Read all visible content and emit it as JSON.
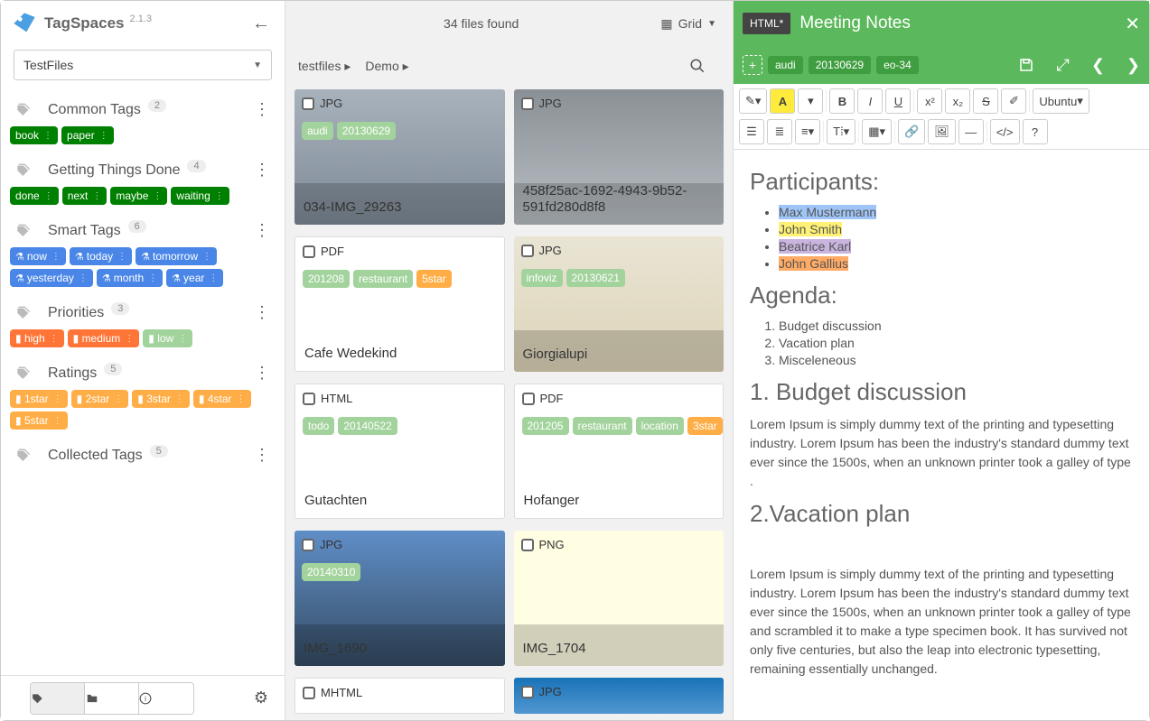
{
  "app": {
    "name": "TagSpaces",
    "version": "2.1.3"
  },
  "location": "TestFiles",
  "sidebar": {
    "groups": [
      {
        "name": "Common Tags",
        "count": "2",
        "tags": [
          {
            "label": "book",
            "color": "tag-green"
          },
          {
            "label": "paper",
            "color": "tag-green"
          }
        ]
      },
      {
        "name": "Getting Things Done",
        "count": "4",
        "tags": [
          {
            "label": "done",
            "color": "tag-green"
          },
          {
            "label": "next",
            "color": "tag-green"
          },
          {
            "label": "maybe",
            "color": "tag-green"
          },
          {
            "label": "waiting",
            "color": "tag-green"
          }
        ]
      },
      {
        "name": "Smart Tags",
        "count": "6",
        "tags": [
          {
            "label": "now",
            "color": "tag-blue",
            "flask": true
          },
          {
            "label": "today",
            "color": "tag-blue",
            "flask": true
          },
          {
            "label": "tomorrow",
            "color": "tag-blue",
            "flask": true
          },
          {
            "label": "yesterday",
            "color": "tag-blue",
            "flask": true
          },
          {
            "label": "month",
            "color": "tag-blue",
            "flask": true
          },
          {
            "label": "year",
            "color": "tag-blue",
            "flask": true
          }
        ]
      },
      {
        "name": "Priorities",
        "count": "3",
        "tags": [
          {
            "label": "high",
            "color": "tag-red",
            "pre": "▮"
          },
          {
            "label": "medium",
            "color": "tag-orange",
            "pre": "▮"
          },
          {
            "label": "low",
            "color": "tag-light",
            "pre": "▮"
          }
        ]
      },
      {
        "name": "Ratings",
        "count": "5",
        "tags": [
          {
            "label": "1star",
            "color": "tag-yellow",
            "pre": "▮"
          },
          {
            "label": "2star",
            "color": "tag-yellow",
            "pre": "▮"
          },
          {
            "label": "3star",
            "color": "tag-yellow",
            "pre": "▮"
          },
          {
            "label": "4star",
            "color": "tag-yellow",
            "pre": "▮"
          },
          {
            "label": "5star",
            "color": "tag-yellow",
            "pre": "▮"
          }
        ]
      },
      {
        "name": "Collected Tags",
        "count": "5",
        "tags": []
      }
    ]
  },
  "main": {
    "count_label": "34 files found",
    "view_label": "Grid",
    "breadcrumbs": [
      "testfiles ▸",
      "Demo ▸"
    ],
    "cards": [
      {
        "type": "JPG",
        "name": "034-IMG_29263",
        "thumb": "eiffel",
        "tags": [
          {
            "label": "audi",
            "color": "tag-light"
          },
          {
            "label": "20130629",
            "color": "tag-light"
          }
        ]
      },
      {
        "type": "JPG",
        "name": "458f25ac-1692-4943-9b52-591fd280d8f8",
        "thumb": "car",
        "tags": []
      },
      {
        "type": "PDF",
        "name": "Cafe Wedekind",
        "doc": true,
        "tags": [
          {
            "label": "201208",
            "color": "tag-light"
          },
          {
            "label": "restaurant",
            "color": "tag-light"
          },
          {
            "label": "5star",
            "color": "tag-yellow"
          }
        ]
      },
      {
        "type": "JPG",
        "name": "Giorgialupi",
        "thumb": "chart",
        "tags": [
          {
            "label": "infoviz",
            "color": "tag-light"
          },
          {
            "label": "20130621",
            "color": "tag-light"
          }
        ]
      },
      {
        "type": "HTML",
        "name": "Gutachten",
        "doc": true,
        "tags": [
          {
            "label": "todo",
            "color": "tag-light"
          },
          {
            "label": "20140522",
            "color": "tag-light"
          }
        ]
      },
      {
        "type": "PDF",
        "name": "Hofanger",
        "doc": true,
        "tags": [
          {
            "label": "201205",
            "color": "tag-light"
          },
          {
            "label": "restaurant",
            "color": "tag-light"
          },
          {
            "label": "location",
            "color": "tag-light"
          },
          {
            "label": "3star",
            "color": "tag-yellow"
          }
        ]
      },
      {
        "type": "JPG",
        "name": "IMG_1690",
        "thumb": "terrace",
        "tags": [
          {
            "label": "20140310",
            "color": "tag-light"
          }
        ]
      },
      {
        "type": "PNG",
        "name": "IMG_1704",
        "thumb": "lead",
        "tags": []
      },
      {
        "type": "MHTML",
        "name": "",
        "doc": true,
        "tags": [],
        "half": true
      },
      {
        "type": "JPG",
        "name": "",
        "thumb": "info",
        "tags": [],
        "half": true
      }
    ]
  },
  "panel": {
    "badge": "HTML*",
    "title": "Meeting Notes",
    "tags": [
      "audi",
      "20130629",
      "eo-34"
    ],
    "font": "Ubuntu",
    "doc": {
      "h_participants": "Participants:",
      "participants": [
        {
          "name": "Max Mustermann",
          "hl": "hlblue"
        },
        {
          "name": "John Smith",
          "hl": "hlyellow"
        },
        {
          "name": "Beatrice Karl",
          "hl": "hlpurple"
        },
        {
          "name": "John Gallius",
          "hl": "hlorange"
        }
      ],
      "h_agenda": "Agenda:",
      "agenda": [
        "Budget discussion",
        "Vacation plan",
        "Misceleneous"
      ],
      "h1": "1. Budget discussion",
      "p1": "Lorem Ipsum is simply dummy text of the printing and typesetting industry. Lorem Ipsum has been the industry's standard dummy text ever since the 1500s, when an unknown printer took a galley of type .",
      "h2": "2.Vacation plan",
      "p2": "Lorem Ipsum is simply dummy text of the printing and typesetting industry.  Lorem Ipsum has been the industry's standard dummy text ever since the 1500s, when an unknown printer took a galley of type and scrambled it to make a type specimen book. It has survived not only five centuries, but also the leap into electronic typesetting, remaining essentially unchanged."
    }
  }
}
